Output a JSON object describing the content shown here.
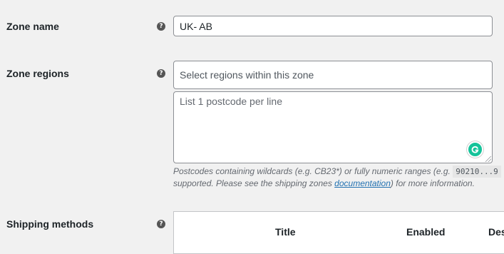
{
  "zone_name": {
    "label": "Zone name",
    "value": "UK- AB",
    "help_icon": "question-icon"
  },
  "zone_regions": {
    "label": "Zone regions",
    "regions_placeholder": "Select regions within this zone",
    "postcodes_placeholder": "List 1 postcode per line",
    "help_icon": "question-icon",
    "description": {
      "part1": "Postcodes containing wildcards (e.g. CB23*) or fully numeric ranges (e.g.",
      "code": "90210...9",
      "part2": "supported. Please see the shipping zones",
      "link": "documentation",
      "part3": ") for more information."
    }
  },
  "shipping_methods": {
    "label": "Shipping methods",
    "help_icon": "question-icon",
    "columns": [
      "Title",
      "Enabled",
      "Des"
    ]
  },
  "colors": {
    "background": "#f1f1f1",
    "grammarly": "#15c39a",
    "link": "#2271b1"
  }
}
